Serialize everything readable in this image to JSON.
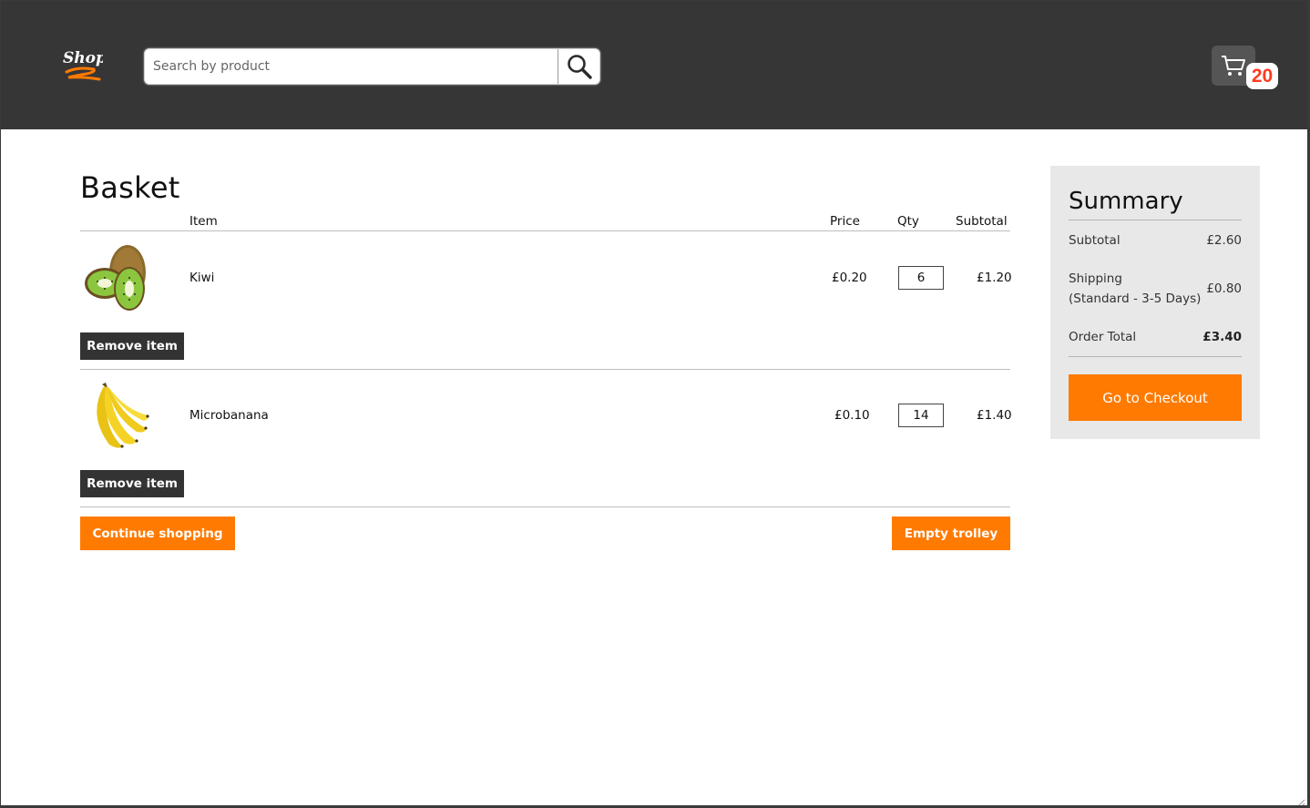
{
  "header": {
    "logo_text": "Shop",
    "search": {
      "placeholder": "Search by product",
      "value": ""
    },
    "cart_count": "20"
  },
  "basket": {
    "title": "Basket",
    "columns": {
      "item": "Item",
      "price": "Price",
      "qty": "Qty",
      "subtotal": "Subtotal"
    },
    "items": [
      {
        "name": "Kiwi",
        "price": "£0.20",
        "qty": "6",
        "subtotal": "£1.20",
        "remove_label": "Remove item",
        "image": "kiwi-image"
      },
      {
        "name": "Microbanana",
        "price": "£0.10",
        "qty": "14",
        "subtotal": "£1.40",
        "remove_label": "Remove item",
        "image": "banana-image"
      }
    ],
    "continue_label": "Continue shopping",
    "empty_label": "Empty trolley"
  },
  "summary": {
    "title": "Summary",
    "subtotal_label": "Subtotal",
    "subtotal_value": "£2.60",
    "shipping_label_1": "Shipping",
    "shipping_label_2": "(Standard - 3-5 Days)",
    "shipping_value": "£0.80",
    "total_label": "Order Total",
    "total_value": "£3.40",
    "checkout_label": "Go to Checkout"
  },
  "colors": {
    "header_bg": "#363636",
    "accent": "#ff7a00",
    "badge_text": "#ff3b1f",
    "summary_bg": "#e8e8e8",
    "dark_button": "#333333"
  }
}
